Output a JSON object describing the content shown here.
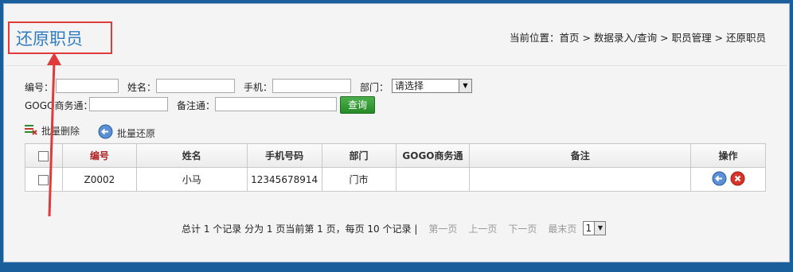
{
  "header": {
    "title": "还原职员",
    "breadcrumb": "当前位置：首页 > 数据录入/查询 > 职员管理 > 还原职员"
  },
  "search": {
    "code_label": "编号：",
    "code_value": "",
    "name_label": "姓名：",
    "name_value": "",
    "phone_label": "手机：",
    "phone_value": "",
    "dept_label": "部门：",
    "dept_selected": "请选择",
    "gogo_label": "GOGO商务通：",
    "gogo_value": "",
    "remark_label": "备注通：",
    "remark_value": "",
    "query_label": "查询"
  },
  "actions": {
    "batch_delete": "批量删除",
    "batch_restore": "批量还原"
  },
  "table": {
    "columns": [
      "编号",
      "姓名",
      "手机号码",
      "部门",
      "GOGO商务通",
      "备注",
      "操作"
    ],
    "rows": [
      {
        "code": "Z0002",
        "name": "小马",
        "phone": "12345678914",
        "dept": "门市",
        "gogo": "",
        "remark": ""
      }
    ]
  },
  "pager": {
    "summary": "总计 1 个记录 分为 1 页当前第 1 页，每页 10 个记录 |",
    "first": "第一页",
    "prev": "上一页",
    "next": "下一页",
    "last": "最末页",
    "page_selected": "1"
  },
  "colors": {
    "annotation": "#e03a3a",
    "title": "#2f7cc0",
    "query_button": "#268a26"
  },
  "icons": [
    "batch-delete-icon",
    "batch-restore-icon",
    "restore-icon",
    "delete-icon",
    "chevron-down-icon"
  ]
}
